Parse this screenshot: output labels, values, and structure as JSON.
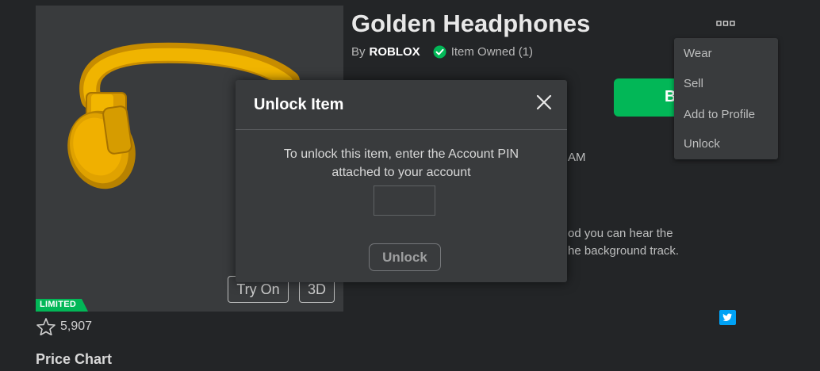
{
  "item": {
    "title": "Golden Headphones",
    "by_label": "By",
    "creator": "ROBLOX",
    "owned_text": "Item Owned (1)",
    "badge": "LIMITED",
    "favorites": "5,907",
    "section_price_chart": "Price Chart"
  },
  "thumbnail_buttons": {
    "try_on": "Try On",
    "three_d": "3D"
  },
  "purchase": {
    "buy_label_partial": "B"
  },
  "background_text": {
    "time_fragment": "AM",
    "desc_line1": "od you can hear the",
    "desc_line2": "he background track."
  },
  "context_menu": {
    "items": [
      "Wear",
      "Sell",
      "Add to Profile",
      "Unlock"
    ]
  },
  "modal": {
    "title": "Unlock Item",
    "message_line1": "To unlock this item, enter the Account PIN",
    "message_line2": "attached to your account",
    "pin_value": "",
    "unlock_button": "Unlock"
  },
  "icons": {
    "close": "close-icon",
    "more": "more-dots-icon",
    "verified": "checkmark-icon",
    "favorite": "star-icon",
    "twitter": "twitter-icon"
  },
  "colors": {
    "background": "#232527",
    "panel": "#393b3d",
    "accent_green": "#02b757",
    "limited_green": "#02b757",
    "twitter_blue": "#00a2f5",
    "headphone_gold": "#e6a500"
  }
}
